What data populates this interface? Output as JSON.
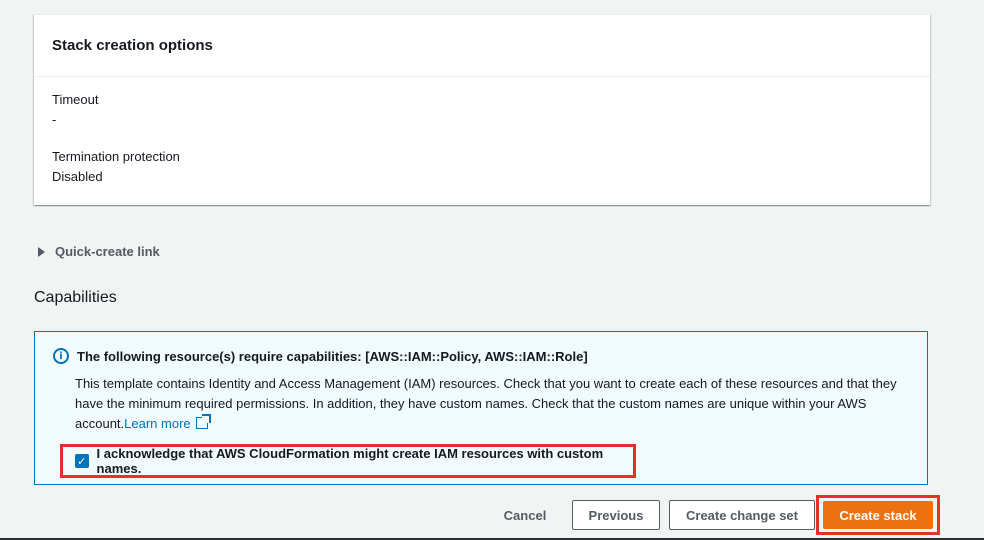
{
  "stack_options": {
    "title": "Stack creation options",
    "timeout_label": "Timeout",
    "timeout_value": "-",
    "termination_label": "Termination protection",
    "termination_value": "Disabled"
  },
  "quick_create": {
    "label": "Quick-create link"
  },
  "capabilities": {
    "title": "Capabilities",
    "alert_title": "The following resource(s) require capabilities: [AWS::IAM::Policy, AWS::IAM::Role]",
    "alert_body": "This template contains Identity and Access Management (IAM) resources. Check that you want to create each of these resources and that they have the minimum required permissions. In addition, they have custom names. Check that the custom names are unique within your AWS account.",
    "learn_more": "Learn more",
    "ack_label": "I acknowledge that AWS CloudFormation might create IAM resources with custom names.",
    "ack_checked": true
  },
  "footer": {
    "cancel": "Cancel",
    "previous": "Previous",
    "create_change_set": "Create change set",
    "create_stack": "Create stack"
  },
  "colors": {
    "primary": "#ec7211",
    "info": "#0073bb",
    "highlight": "#e4312b"
  },
  "icons": {
    "alert": "info-icon",
    "link": "external-link-icon",
    "expand": "caret-right-icon"
  }
}
